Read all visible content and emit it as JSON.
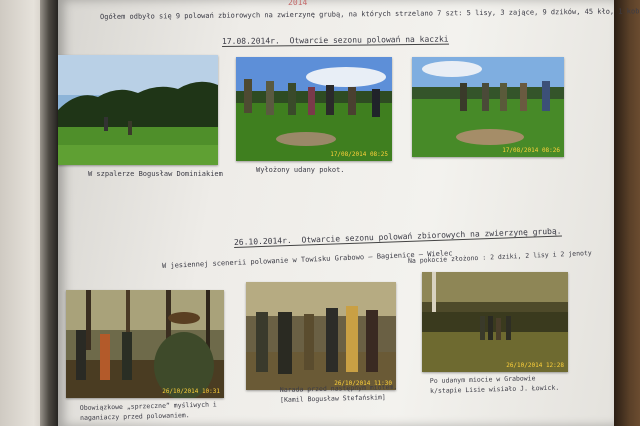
{
  "top_line_red": "2014",
  "intro": "Ogółem odbyło się 9 polowań zbiorowych na zwierzynę grubą, na których strzelano 7 szt: 5 lisy, 3 zające, 9 dzików, 45 kło, 1 kobuz, 3 lisów, 2 jeleń, 1 sarny",
  "section1": {
    "date": "17.08.2014r.",
    "heading": "Otwarcie sezonu polowań na kaczki"
  },
  "row1": [
    {
      "caption": "W szpalerze Bogusław Dominiakiem",
      "stamp": ""
    },
    {
      "caption": "Wyłożony udany pokot.",
      "stamp": "17/08/2014 08:25"
    },
    {
      "caption": "",
      "stamp": "17/08/2014 08:26"
    }
  ],
  "section2": {
    "date": "26.10.2014r.",
    "heading": "Otwarcie sezonu polowań zbiorowych na zwierzynę grubą."
  },
  "autumn_line": "W jesiennej scenerii polowanie w Towisku Grabowo – Bagienice – Wielec",
  "bag_line": "Na pokocie złożono : 2 dziki, 2 lisy i 2 jenoty",
  "row2": [
    {
      "caption": "Obowiązkowe „sprzeczne” myśliwych i naganiaczy przed polowaniem.",
      "stamp": "26/10/2014 10:31"
    },
    {
      "caption": "Narada przed następnym miotem. [Kamil Bogusław Stefańskim]",
      "stamp": "26/10/2014 11:30"
    },
    {
      "caption": "Po udanym miocie w Grabowie k/stapie Lisie wisiało J. Łowick.",
      "stamp": "26/10/2014 12:28"
    }
  ]
}
